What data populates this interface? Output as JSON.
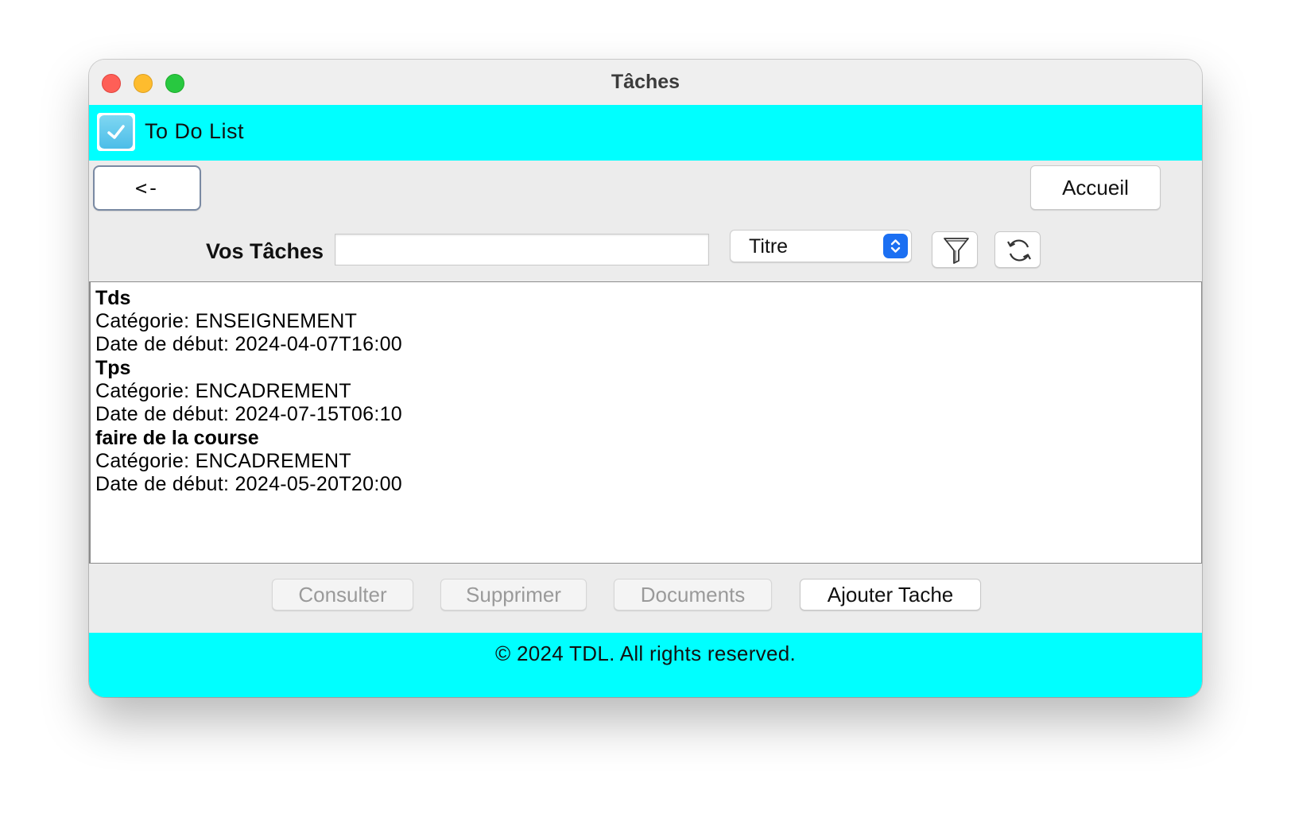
{
  "window": {
    "title": "Tâches"
  },
  "header": {
    "app_name": "To Do List",
    "logo_icon": "checkbox-icon"
  },
  "nav": {
    "back_label": "<-",
    "home_label": "Accueil"
  },
  "search": {
    "label": "Vos Tâches",
    "value": "",
    "placeholder": ""
  },
  "sort": {
    "selected": "Titre"
  },
  "toolbar_icons": {
    "filter": "filter-icon",
    "refresh": "refresh-icon"
  },
  "tasks": [
    {
      "title": "Tds",
      "category": "Catégorie: ENSEIGNEMENT",
      "start": "Date de début: 2024-04-07T16:00"
    },
    {
      "title": "Tps",
      "category": "Catégorie: ENCADREMENT",
      "start": "Date de début: 2024-07-15T06:10"
    },
    {
      "title": "faire de la course",
      "category": "Catégorie: ENCADREMENT",
      "start": "Date de début: 2024-05-20T20:00"
    }
  ],
  "actions": {
    "consult_label": "Consulter",
    "delete_label": "Supprimer",
    "documents_label": "Documents",
    "add_label": "Ajouter Tache"
  },
  "footer": {
    "copyright": "© 2024 TDL. All rights reserved."
  },
  "colors": {
    "band": "#00ffff",
    "select_accent": "#1b6ff2"
  }
}
